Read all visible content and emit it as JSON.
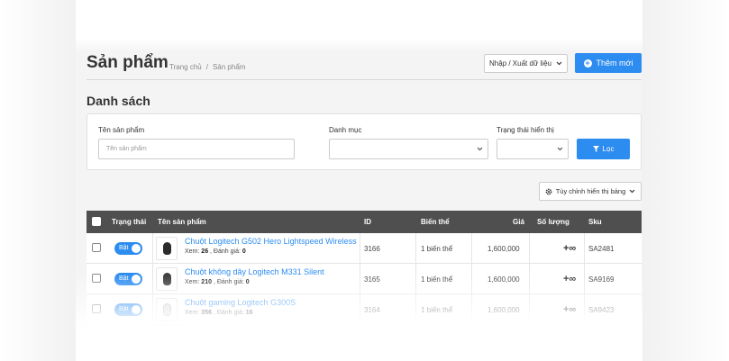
{
  "header": {
    "title": "Sản phẩm",
    "breadcrumb": [
      "Trang chủ",
      "Sản phẩm"
    ],
    "import_export_label": "Nhập / Xuất dữ liệu",
    "add_new_label": "Thêm mới"
  },
  "list": {
    "title": "Danh sách"
  },
  "filters": {
    "name_label": "Tên sản phẩm",
    "name_placeholder": "Tên sản phẩm",
    "category_label": "Danh mục",
    "category_value": "",
    "status_label": "Trạng thái hiển thị",
    "status_value": "",
    "filter_button": "Lọc"
  },
  "table_settings_label": "Tùy chỉnh hiển thị bảng",
  "table": {
    "columns": {
      "status": "Trạng thái",
      "name": "Tên sản phẩm",
      "id": "ID",
      "variant": "Biến thể",
      "price": "Giá",
      "quantity": "Số lượng",
      "sku": "Sku"
    },
    "rows": [
      {
        "toggle": "Bật",
        "name": "Chuột Logitech G502 Hero Lightspeed Wireless",
        "views_label": "Xem:",
        "views": "26",
        "rating_label": ", Đánh giá:",
        "rating": "0",
        "id": "3166",
        "variant": "1 biến thể",
        "price": "1,600,000",
        "quantity": "+∞",
        "sku": "SA2481",
        "thumb_color": "#2b2b2b"
      },
      {
        "toggle": "Bật",
        "name": "Chuột không dây Logitech M331 Silent",
        "views_label": "Xem:",
        "views": "210",
        "rating_label": ", Đánh giá:",
        "rating": "0",
        "id": "3165",
        "variant": "1 biến thể",
        "price": "1,600,000",
        "quantity": "+∞",
        "sku": "SA9169",
        "thumb_color": "#3a3a3a"
      },
      {
        "toggle": "Bật",
        "name": "Chuột gaming Logitech G300S",
        "views_label": "Xem:",
        "views": "356",
        "rating_label": ", Đánh giá:",
        "rating": "16",
        "id": "3164",
        "variant": "1 biến thể",
        "price": "1,600,000",
        "quantity": "+∞",
        "sku": "SA9423",
        "thumb_color": "#dcdcdc"
      }
    ]
  },
  "colors": {
    "primary": "#2d8cf0",
    "table_header": "#4f4f4f",
    "link": "#2d8cf0"
  }
}
